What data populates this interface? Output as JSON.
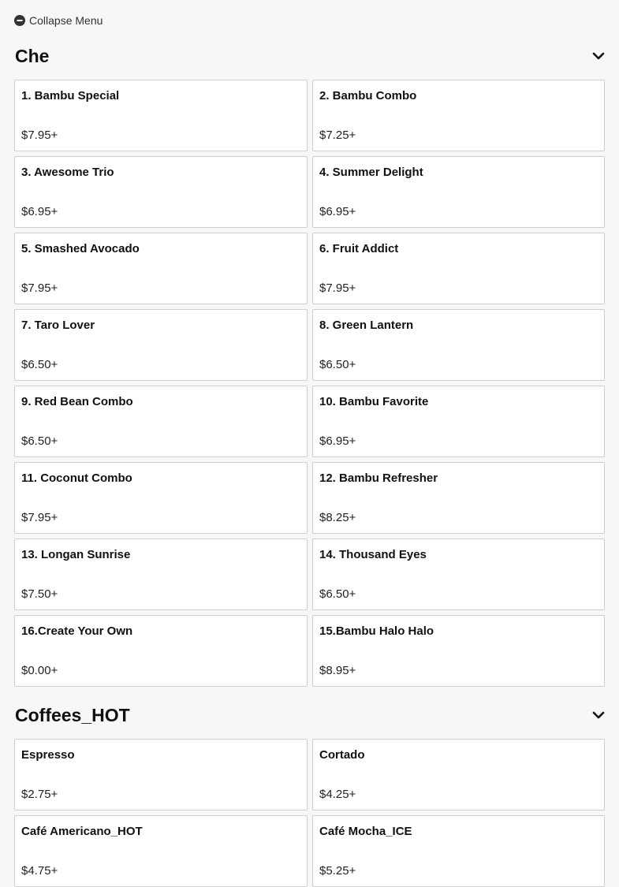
{
  "collapse_menu_label": "Collapse Menu",
  "sections": [
    {
      "title": "Che",
      "items": [
        {
          "name": "1. Bambu Special",
          "price": "$7.95+"
        },
        {
          "name": "2. Bambu Combo",
          "price": "$7.25+"
        },
        {
          "name": "3. Awesome Trio",
          "price": "$6.95+"
        },
        {
          "name": "4. Summer Delight",
          "price": "$6.95+"
        },
        {
          "name": "5. Smashed Avocado",
          "price": "$7.95+"
        },
        {
          "name": "6. Fruit Addict",
          "price": "$7.95+"
        },
        {
          "name": "7. Taro Lover",
          "price": "$6.50+"
        },
        {
          "name": "8. Green Lantern",
          "price": "$6.50+"
        },
        {
          "name": "9. Red Bean Combo",
          "price": "$6.50+"
        },
        {
          "name": "10. Bambu Favorite",
          "price": "$6.95+"
        },
        {
          "name": "11. Coconut Combo",
          "price": "$7.95+"
        },
        {
          "name": "12. Bambu Refresher",
          "price": "$8.25+"
        },
        {
          "name": "13. Longan Sunrise",
          "price": "$7.50+"
        },
        {
          "name": "14. Thousand Eyes",
          "price": "$6.50+"
        },
        {
          "name": "16.Create Your Own",
          "price": "$0.00+"
        },
        {
          "name": "15.Bambu Halo Halo",
          "price": "$8.95+"
        }
      ]
    },
    {
      "title": "Coffees_HOT",
      "items": [
        {
          "name": "Espresso",
          "price": "$2.75+"
        },
        {
          "name": "Cortado",
          "price": "$4.25+"
        },
        {
          "name": "Café Americano_HOT",
          "price": "$4.75+"
        },
        {
          "name": "Café Mocha_ICE",
          "price": "$5.25+"
        }
      ]
    }
  ],
  "icons": {
    "collapse": "minus-circle-icon",
    "section_toggle": "chevron-down-icon"
  }
}
